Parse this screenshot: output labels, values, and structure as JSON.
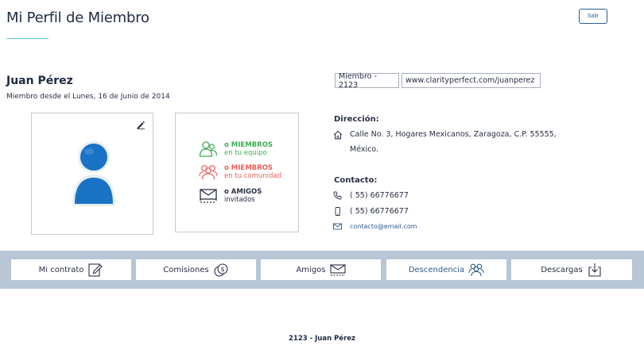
{
  "header": {
    "title": "Mi Perfil de Miembro",
    "logout_label": "Salir"
  },
  "member": {
    "name": "Juan Pérez",
    "since": "Miembro desde el Lunes, 16 de Junio de 2014",
    "id_chip": "Miembro - 2123",
    "url_chip": "www.clarityperfect.com/juanperez"
  },
  "stats": [
    {
      "strong": "o MIEMBROS",
      "sub": "en tu equipo",
      "icon": "team-icon",
      "color": "#3dae54"
    },
    {
      "strong": "o MIEMBROS",
      "sub": "en tu comunidad",
      "icon": "community-icon",
      "color": "#e8605b"
    },
    {
      "strong": "o AMIGOS",
      "sub": "invitados",
      "icon": "invite-envelope-icon",
      "color": "#2a2f45"
    }
  ],
  "address": {
    "label": "Dirección:",
    "line1": "Calle No. 3, Hogares Mexicanos, Zaragoza, C.P. 55555,",
    "line2": "México."
  },
  "contact": {
    "label": "Contacto:",
    "phone": "( 55) 66776677",
    "mobile": "( 55) 66776677",
    "email": "contacto@email.com"
  },
  "tabs": [
    {
      "label": "Mi contrato",
      "icon": "edit-contract-icon"
    },
    {
      "label": "Comisiones",
      "icon": "coins-icon"
    },
    {
      "label": "Amigos",
      "icon": "envelope-icon"
    },
    {
      "label": "Descendencia",
      "icon": "people-icon",
      "active": true
    },
    {
      "label": "Descargas",
      "icon": "download-icon"
    }
  ],
  "footer": {
    "text": "2123 - Juan Pérez"
  },
  "colors": {
    "accent": "#5cc6d6",
    "brand_blue": "#2d5c8a",
    "tabs_bar": "#b8c6d6",
    "green": "#3dae54",
    "red": "#e8605b"
  }
}
